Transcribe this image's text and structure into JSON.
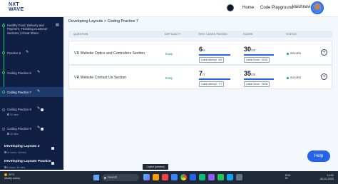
{
  "app": {
    "logo_line1": "NXT",
    "logo_line2": "WAVE"
  },
  "topnav": {
    "home": "Home",
    "code_playground": "Code Playground",
    "user_name": "Vaishnavi"
  },
  "sidebar": {
    "items": [
      {
        "label": "Healthy Food, Delivery and Payment, Thanking Customer Sections | Cheat Sheet",
        "completed": true
      },
      {
        "label": "Practice 6",
        "completed": true
      },
      {
        "label": "Coding Practice 6",
        "completed": true
      },
      {
        "label": "Coding Practice 7",
        "completed": true,
        "active": true
      },
      {
        "label": "Coding Practice 8",
        "locked": true,
        "duration": "15 mins"
      },
      {
        "label": "Coding Practice 9",
        "locked": true,
        "duration": "15 mins"
      }
    ],
    "sections": [
      {
        "label": "Developing Layouts 2",
        "duration": "11 hours, 15 mins",
        "locked": true
      },
      {
        "label": "Developing Layouts Practice",
        "duration": "6 hours, 30 mins",
        "locked": true
      }
    ]
  },
  "main": {
    "breadcrumb": "Developing Layouts > Coding Practice 7",
    "columns": [
      "QUESTION",
      "DIFFICULTY",
      "TEST CASES PASSED",
      "SCORE",
      "STATUS"
    ],
    "rows": [
      {
        "question": "VR Website Optics and Controllers Section",
        "difficulty": "Easy",
        "tests_passed": "6",
        "tests_total": "/6",
        "tests_fraction": 1.0,
        "latest_attempt": "Latest Attempt : 6/6",
        "score": "30",
        "score_total": "/30",
        "score_fraction": 1.0,
        "latest_score": "Latest Score : 30/30",
        "status": "SOLVED"
      },
      {
        "question": "VR Website Contact Us Section",
        "difficulty": "Easy",
        "tests_passed": "7",
        "tests_total": "/7",
        "tests_fraction": 1.0,
        "latest_attempt": "Latest Attempt : 7/7",
        "score": "35",
        "score_total": "/35",
        "score_fraction": 1.0,
        "latest_score": "Latest Score : 35/35",
        "status": "SOLVED"
      }
    ],
    "help_label": "Help"
  },
  "tooltip": "Copilot (preview)",
  "taskbar": {
    "weather_temp": "29°C",
    "weather_desc": "Mostly sunny",
    "search_placeholder": "Search",
    "lang": "ENG",
    "region": "IN",
    "time": "14:02",
    "date": "28-12-2023"
  },
  "colors": {
    "sidebar_bg": "#0f2044",
    "accent": "#2563eb",
    "easy": "#16a34a"
  }
}
